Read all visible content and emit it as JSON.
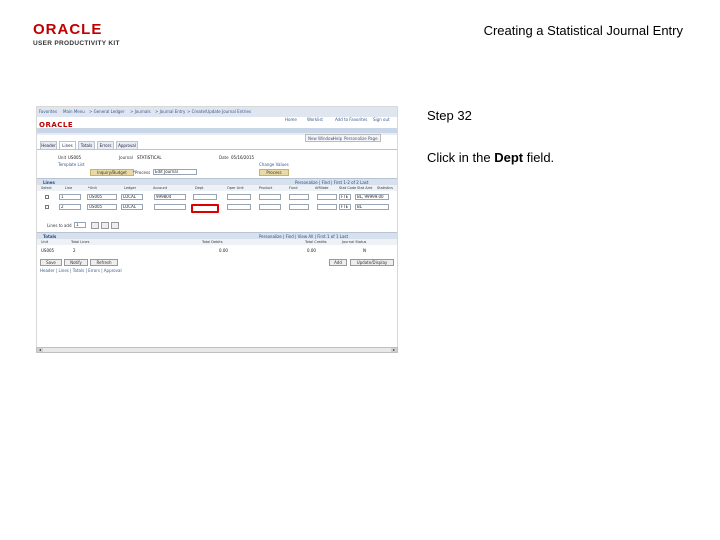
{
  "logo": {
    "brand": "ORACLE",
    "product": "USER PRODUCTIVITY KIT"
  },
  "doc_title": "Creating a Statistical Journal Entry",
  "step": {
    "label": "Step 32"
  },
  "instruction": {
    "before": "Click in the ",
    "field": "Dept",
    "after": " field."
  },
  "screenshot": {
    "nav": [
      "Favorites",
      "Main Menu",
      "> General Ledger",
      "> Journals",
      "> Journal Entry",
      "> Create/Update Journal Entries"
    ],
    "top_links": [
      "Home",
      "Worklist",
      "Add to Favorites",
      "Sign out"
    ],
    "header_links": [
      "New Window",
      "Help",
      "Personalize Page"
    ],
    "tabs": [
      "Header",
      "Lines",
      "Totals",
      "Errors",
      "Approval"
    ],
    "fields": {
      "unit_label": "Unit",
      "unit_value": "US005",
      "journal_label": "Journal",
      "journal_value": "STATISTICAL",
      "date_label": "Date",
      "date_value": "05/16/2015",
      "template_label": "Template List",
      "change_values": "Change Values",
      "process_label": "*Process",
      "process_value": "Edit Journal",
      "process_button": "Process",
      "search_button": "Inquiry/Budget"
    },
    "lines_section": {
      "title": "Lines",
      "nav": "Personalize | Find | First 1-2 of 2 Last",
      "columns": [
        "Select",
        "Line",
        "*Unit",
        "Ledger",
        "Account",
        "Dept",
        "Oper Unit",
        "Product",
        "Fund",
        "Affiliate",
        "Stat Code",
        "Stat Amt",
        "Statistics"
      ],
      "rows": [
        {
          "line": "1",
          "unit": "US005",
          "ledger": "LOCAL",
          "account": "999804",
          "stat": "FTE",
          "amount": "BL, 99999.00"
        },
        {
          "line": "2",
          "unit": "US005",
          "ledger": "LOCAL",
          "account": "",
          "stat": "FTE",
          "amount": "BL"
        }
      ],
      "lines_to_add_label": "Lines to add",
      "lines_to_add_value": "1"
    },
    "totals_section": {
      "title": "Totals",
      "nav": "Personalize | Find | View All | First 1 of 1 Last",
      "columns": [
        "Unit",
        "Total Lines",
        "Total Debits",
        "Total Credits",
        "Journal Status"
      ],
      "row": {
        "unit": "US005",
        "lines": "2",
        "debits": "0.00",
        "credits": "0.00",
        "status": "N"
      }
    },
    "buttons": {
      "save": "Save",
      "notify": "Notify",
      "refresh": "Refresh",
      "add": "Add",
      "update": "Update/Display"
    },
    "footer_links": "Header | Lines | Totals | Errors | Approval"
  }
}
